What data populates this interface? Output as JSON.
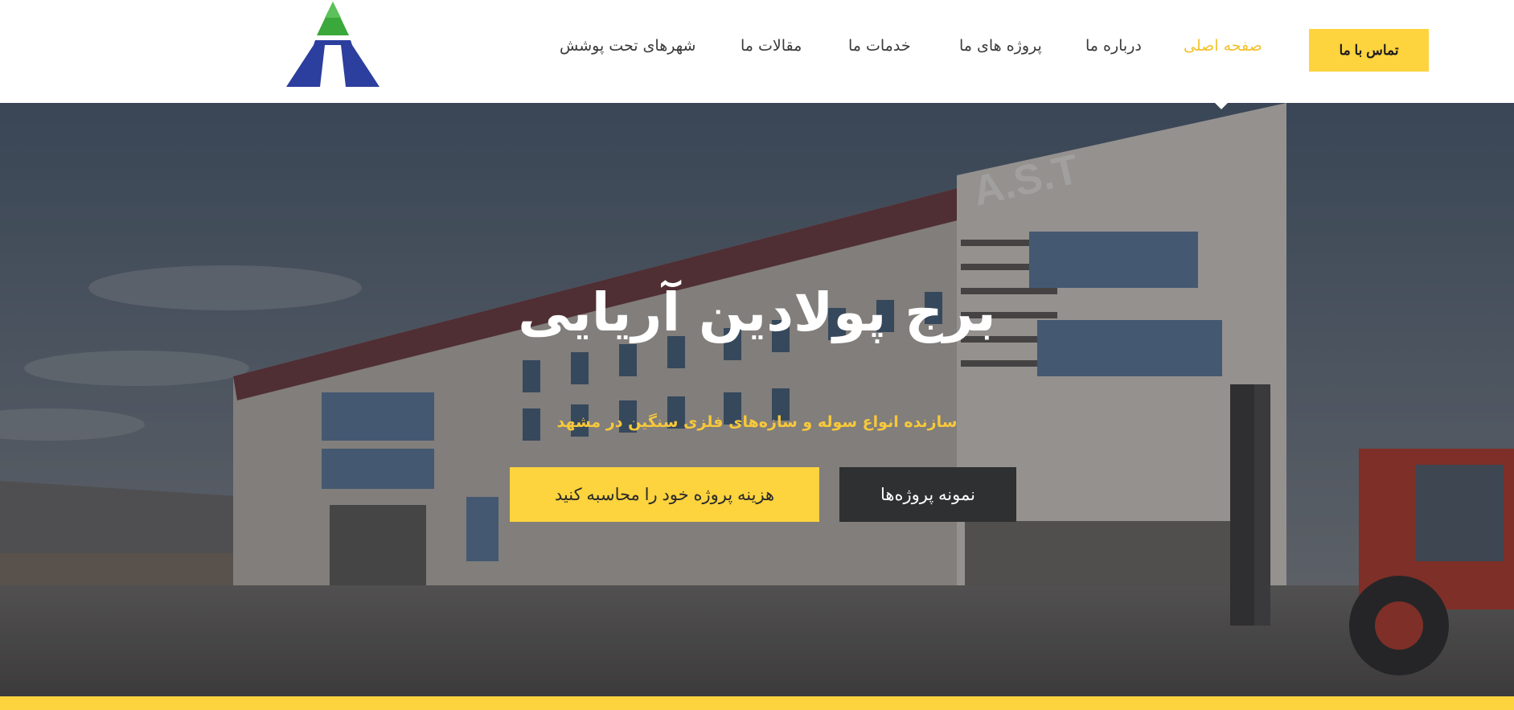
{
  "header": {
    "contact_label": "تماس با ما",
    "nav": [
      {
        "label": "صفحه اصلی",
        "active": true
      },
      {
        "label": "درباره ما"
      },
      {
        "label": "پروژه های ما"
      },
      {
        "label": "خدمات ما"
      },
      {
        "label": "مقالات ما"
      },
      {
        "label": "شهرهای تحت پوشش"
      }
    ]
  },
  "hero": {
    "title": "برج پولادین آریایی",
    "subtitle": "سازنده انواع سوله و سازه‌های فلزی سنگین در مشهد",
    "building_sign": "A.S.T",
    "cost_button": "هزینه پروژه خود را محاسبه کنید",
    "projects_button": "نمونه پروژه‌ها"
  },
  "colors": {
    "accent": "#fdd33e",
    "active_nav": "#f2c230",
    "dark_button": "#2f3032",
    "logo_green": "#3aa83a",
    "logo_blue": "#2c3e9e"
  },
  "icons": {
    "logo": "triangle-logo-icon"
  }
}
